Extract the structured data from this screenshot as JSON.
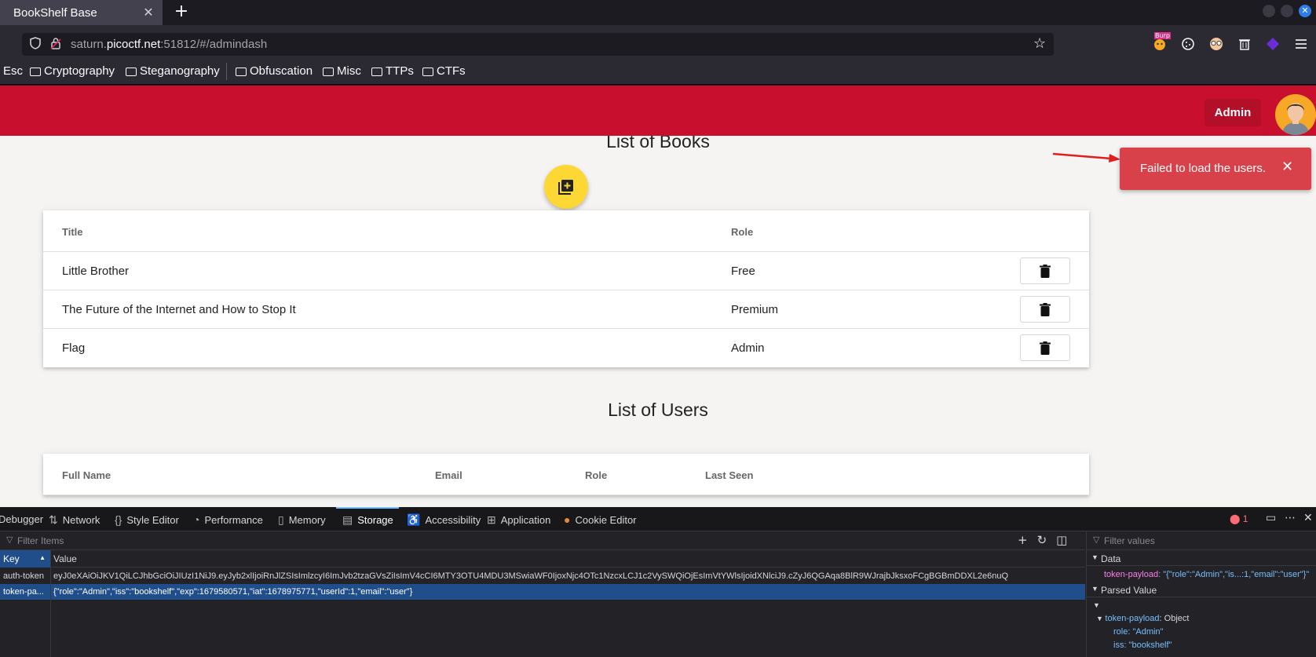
{
  "browser": {
    "tab_title": "BookShelf Base",
    "tab_close": "✕",
    "new_tab": "+",
    "url_prefix": "saturn.",
    "url_domain": "picoctf.net",
    "url_suffix": ":51812/#/admindash",
    "bookmarks": [
      "Esc",
      "Cryptography",
      "Steganography",
      "Obfuscation",
      "Misc",
      "TTPs",
      "CTFs"
    ],
    "extensions": [
      "burp-icon",
      "cookie-icon",
      "glasses-icon",
      "trash-icon",
      "extension-icon",
      "menu-icon"
    ],
    "burp_label": "Burp"
  },
  "app": {
    "admin_label": "Admin",
    "books_title": "List of Books",
    "users_title": "List of Users",
    "toast_message": "Failed to load the users.",
    "toast_close": "✕",
    "books_headers": {
      "title": "Title",
      "role": "Role"
    },
    "books": [
      {
        "title": "Little Brother",
        "role": "Free"
      },
      {
        "title": "The Future of the Internet and How to Stop It",
        "role": "Premium"
      },
      {
        "title": "Flag",
        "role": "Admin"
      }
    ],
    "users_headers": {
      "full_name": "Full Name",
      "email": "Email",
      "role": "Role",
      "last_seen": "Last Seen"
    },
    "colors": {
      "header": "#c8102e",
      "fab": "#fdd835",
      "toast": "#d9414a"
    }
  },
  "devtools": {
    "tabs": [
      "Debugger",
      "Network",
      "Style Editor",
      "Performance",
      "Memory",
      "Storage",
      "Accessibility",
      "Application",
      "Cookie Editor"
    ],
    "active_tab": "Storage",
    "error_count": "1",
    "filter_placeholder": "Filter Items",
    "key_header": "Key",
    "value_header": "Value",
    "rows": [
      {
        "key": "auth-token",
        "value": "eyJ0eXAiOiJKV1QiLCJhbGciOiJIUzI1NiJ9.eyJyb2xlIjoiRnJlZSIsImlzcyI6ImJvb2tzaGVsZiIsImV4cCI6MTY3OTU4MDU3MSwiaWF0IjoxNjc4OTc1NzcxLCJ1c2VySWQiOjEsImVtYWlsIjoidXNlciJ9.cZyJ6QGAqa8BlR9WJrajbJksxoFCgBGBmDDXL2e6nuQ"
      },
      {
        "key": "token-pa...",
        "value": "{\"role\":\"Admin\",\"iss\":\"bookshelf\",\"exp\":1679580571,\"iat\":1678975771,\"userId\":1,\"email\":\"user\"}"
      }
    ],
    "sidebar": {
      "filter_placeholder": "Filter values",
      "data_label": "Data",
      "data_key": "token-payload",
      "data_value": ": \"{\"role\":\"Admin\",\"is...:1,\"email\":\"user\"}\"",
      "parsed_label": "Parsed Value",
      "obj_key": "token-payload",
      "obj_type": ": Object",
      "role_key": "role",
      "role_value": ": \"Admin\"",
      "iss_key": "iss",
      "iss_value": ": \"bookshelf\""
    }
  }
}
